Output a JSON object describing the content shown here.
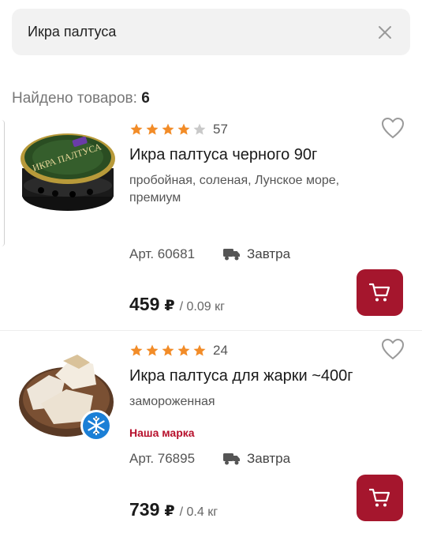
{
  "search": {
    "query": "Икра палтуса",
    "clear_icon": "close-icon"
  },
  "results": {
    "label": "Найдено товаров:",
    "count": "6"
  },
  "colors": {
    "accent": "#a5162d",
    "star": "#f28c28",
    "brand_label": "#b7102c"
  },
  "products": [
    {
      "rating_count": "57",
      "rating": 4,
      "title": "Икра палтуса черного 90г",
      "description": "пробойная, соленая, Лунское море, премиум",
      "brand": "",
      "article": "Арт. 60681",
      "delivery": "Завтра",
      "price": "459",
      "currency": "₽",
      "unit": "/ 0.09 кг",
      "image": "caviar-jar",
      "jar_label": "ИКРА ПАЛТУСА"
    },
    {
      "rating_count": "24",
      "rating": 5,
      "title": "Икра палтуса для жарки ~400г",
      "description": "замороженная",
      "brand": "Наша марка",
      "article": "Арт. 76895",
      "delivery": "Завтра",
      "price": "739",
      "currency": "₽",
      "unit": "/ 0.4 кг",
      "image": "frozen-roe-on-board"
    }
  ]
}
